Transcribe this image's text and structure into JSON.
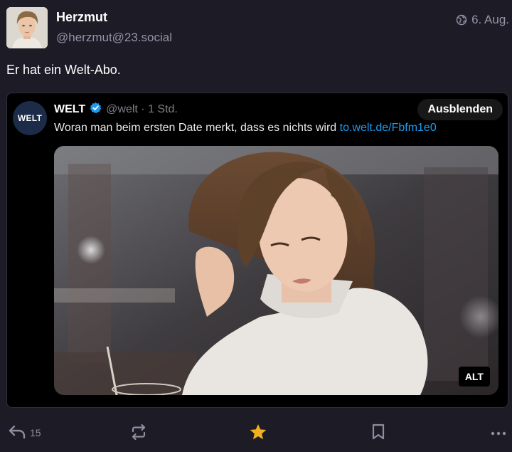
{
  "author": {
    "name": "Herzmut",
    "handle": "@herzmut@23.social",
    "timestamp": "6. Aug."
  },
  "post": {
    "text": "Er hat ein Welt-Abo."
  },
  "embed": {
    "logo_text": "WELT",
    "name": "WELT",
    "meta": "@welt · 1 Std.",
    "hide_label": "Ausblenden",
    "text": "Woran man beim ersten Date merkt, dass es nichts wird ",
    "link": "to.welt.de/Fbfm1e0",
    "alt_label": "ALT"
  },
  "actions": {
    "reply_count": "15"
  },
  "colors": {
    "background": "#1c1b26",
    "muted": "#9594a8",
    "favourite_star": "#f2b01e",
    "link": "#1d9bf0",
    "verified": "#1d9bf0"
  },
  "icons": [
    "globe-icon",
    "verified-icon",
    "reply-icon",
    "boost-icon",
    "star-icon",
    "bookmark-icon",
    "more-icon"
  ]
}
